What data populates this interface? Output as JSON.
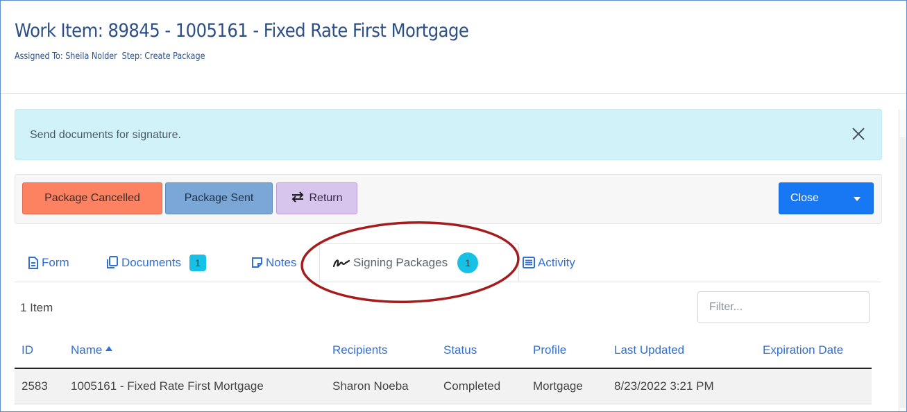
{
  "header": {
    "title": "Work Item: 89845 - 1005161 - Fixed Rate First Mortgage",
    "assigned_to": "Assigned To: Sheila Nolder",
    "step": "Step: Create Package"
  },
  "alert": {
    "message": "Send documents for signature."
  },
  "toolbar": {
    "package_cancelled_label": "Package Cancelled",
    "package_sent_label": "Package Sent",
    "return_label": "Return",
    "close_label": "Close"
  },
  "tabs": [
    {
      "label": "Form",
      "icon": "file-text-icon"
    },
    {
      "label": "Documents",
      "icon": "copy-icon",
      "badge": "1"
    },
    {
      "label": "Notes",
      "icon": "note-icon"
    },
    {
      "label": "Signing Packages",
      "icon": "signature-icon",
      "badge": "1",
      "active": true
    },
    {
      "label": "Activity",
      "icon": "list-alt-icon"
    }
  ],
  "list": {
    "count_label": "1 Item",
    "filter_placeholder": "Filter..."
  },
  "table": {
    "columns": [
      "ID",
      "Name",
      "Recipients",
      "Status",
      "Profile",
      "Last Updated",
      "Expiration Date"
    ],
    "rows": [
      {
        "id": "2583",
        "name": "1005161 - Fixed Rate First Mortgage",
        "recipients": "Sharon Noeba",
        "status": "Completed",
        "profile": "Mortgage",
        "last_updated": "8/23/2022 3:21 PM",
        "expiration_date": ""
      }
    ]
  },
  "colors": {
    "title": "#2c4f86",
    "link": "#2f6fd6",
    "alert_bg": "#d1f2f9",
    "cancelled_btn": "#fd8262",
    "sent_btn": "#7aa7d5",
    "return_btn": "#d8c5ee",
    "close_btn": "#1877f2",
    "badge": "#17c0e5",
    "annotation": "#a51c1c"
  }
}
